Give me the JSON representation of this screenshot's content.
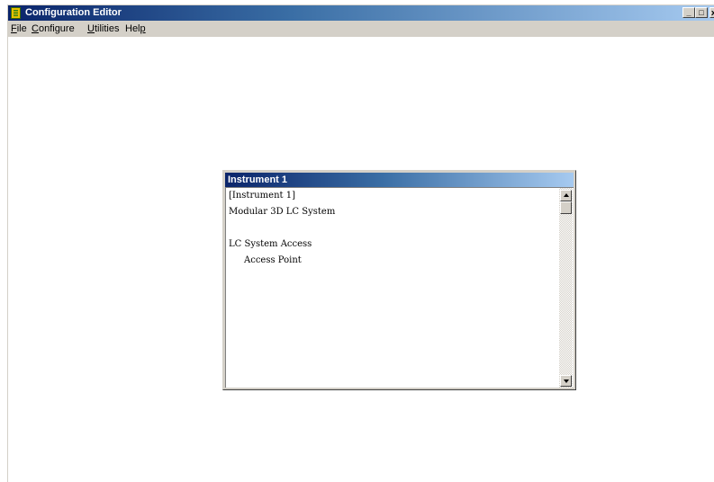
{
  "app": {
    "title": "Configuration Editor",
    "controls": {
      "minimize": "_",
      "maximize": "□",
      "close": "x"
    }
  },
  "menu": [
    {
      "label": "File",
      "hotkey": "F",
      "rest": "ile"
    },
    {
      "label": "Configure",
      "hotkey": "C",
      "rest": "onfigure"
    },
    {
      "label": "Utilities",
      "hotkey": "U",
      "rest": "tilities"
    },
    {
      "label": "Help",
      "hotkey": "p",
      "prefix": "Hel",
      "rest": ""
    }
  ],
  "child": {
    "title": "Instrument 1",
    "lines": [
      "[Instrument 1]",
      "Modular 3D LC System",
      "",
      "LC System Access",
      "Access Point"
    ]
  },
  "colors": {
    "titlebar_start": "#0a246a",
    "titlebar_end": "#a6caf0",
    "face": "#d4d0c8"
  }
}
